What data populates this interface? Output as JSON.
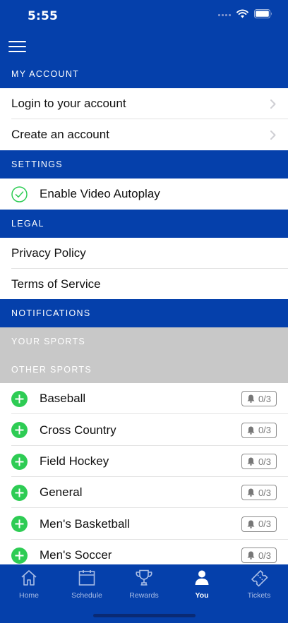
{
  "status_bar": {
    "time": "5:55"
  },
  "sections": {
    "my_account": "MY ACCOUNT",
    "settings": "SETTINGS",
    "legal": "LEGAL",
    "notifications": "NOTIFICATIONS",
    "your_sports": "YOUR SPORTS",
    "other_sports": "OTHER SPORTS"
  },
  "account": {
    "login": "Login to your account",
    "create": "Create an account"
  },
  "settings": {
    "autoplay": "Enable Video Autoplay",
    "autoplay_enabled": true
  },
  "legal": {
    "privacy": "Privacy Policy",
    "terms": "Terms of Service"
  },
  "sports": [
    {
      "name": "Baseball",
      "count": "0/3"
    },
    {
      "name": "Cross Country",
      "count": "0/3"
    },
    {
      "name": "Field Hockey",
      "count": "0/3"
    },
    {
      "name": "General",
      "count": "0/3"
    },
    {
      "name": "Men's Basketball",
      "count": "0/3"
    },
    {
      "name": "Men's Soccer",
      "count": "0/3"
    }
  ],
  "tabs": [
    {
      "label": "Home",
      "icon": "home-icon"
    },
    {
      "label": "Schedule",
      "icon": "calendar-icon"
    },
    {
      "label": "Rewards",
      "icon": "trophy-icon"
    },
    {
      "label": "You",
      "icon": "person-icon",
      "active": true
    },
    {
      "label": "Tickets",
      "icon": "ticket-icon"
    }
  ],
  "colors": {
    "brand_blue": "#0540ab",
    "gray_header": "#c8c8c8",
    "accent_green": "#2ecc54"
  }
}
